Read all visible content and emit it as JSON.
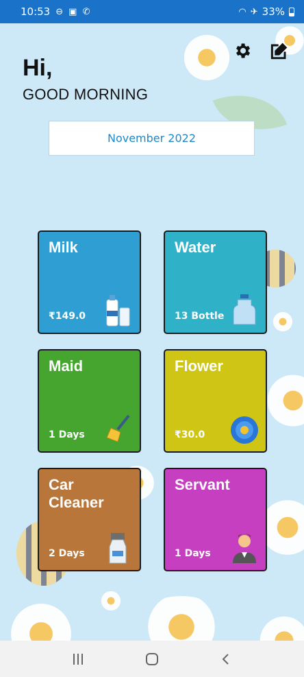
{
  "status": {
    "time": "10:53",
    "battery": "33%"
  },
  "greeting": {
    "hi": "Hi,",
    "message": "GOOD MORNING"
  },
  "month": "November 2022",
  "cards": [
    {
      "title": "Milk",
      "sub": "₹149.0",
      "icon": "milk-bottle-icon",
      "color": "#2f9fd3"
    },
    {
      "title": "Water",
      "sub": "13 Bottle",
      "icon": "water-bottle-icon",
      "color": "#2fb1c8"
    },
    {
      "title": "Maid",
      "sub": "1 Days",
      "icon": "broom-icon",
      "color": "#45a52f"
    },
    {
      "title": "Flower",
      "sub": "₹30.0",
      "icon": "flower-icon",
      "color": "#cfc514"
    },
    {
      "title": "Car Cleaner",
      "sub": "2 Days",
      "icon": "spray-bottle-icon",
      "color": "#b8763a"
    },
    {
      "title": "Servant",
      "sub": "1 Days",
      "icon": "servant-icon",
      "color": "#c63fc0"
    }
  ]
}
